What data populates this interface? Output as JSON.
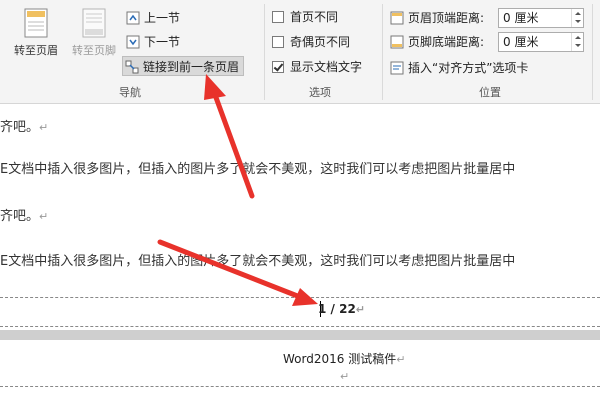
{
  "ribbon": {
    "nav": {
      "goto_header": "转至页眉",
      "goto_footer": "转至页脚",
      "prev_section": "上一节",
      "next_section": "下一节",
      "link_prev": "链接到前一条页眉",
      "group_label": "导航"
    },
    "options": {
      "first_page_diff": "首页不同",
      "odd_even_diff": "奇偶页不同",
      "show_doc_text": "显示文档文字",
      "first_page_checked": false,
      "odd_even_checked": false,
      "show_doc_text_checked": true,
      "group_label": "选项"
    },
    "position": {
      "header_top_label": "页眉顶端距离:",
      "header_top_value": "0 厘米",
      "footer_bottom_label": "页脚底端距离:",
      "footer_bottom_value": "0 厘米",
      "insert_align_tab": "插入“对齐方式”选项卡",
      "group_label": "位置"
    }
  },
  "document": {
    "line1": "齐吧。",
    "line2": "E文档中插入很多图片，但插入的图片多了就会不美观，这时我们可以考虑把图片批量居中",
    "line3": "齐吧。",
    "line4": "E文档中插入很多图片，但插入的图片多了就会不美观，这时我们可以考虑把图片批量居中",
    "para_mark": "↵",
    "page_number": "1 / 22",
    "next_header": "Word2016 测试稿件"
  },
  "colors": {
    "arrow": "#e8322b",
    "accent_blue": "#2b6cb6"
  }
}
